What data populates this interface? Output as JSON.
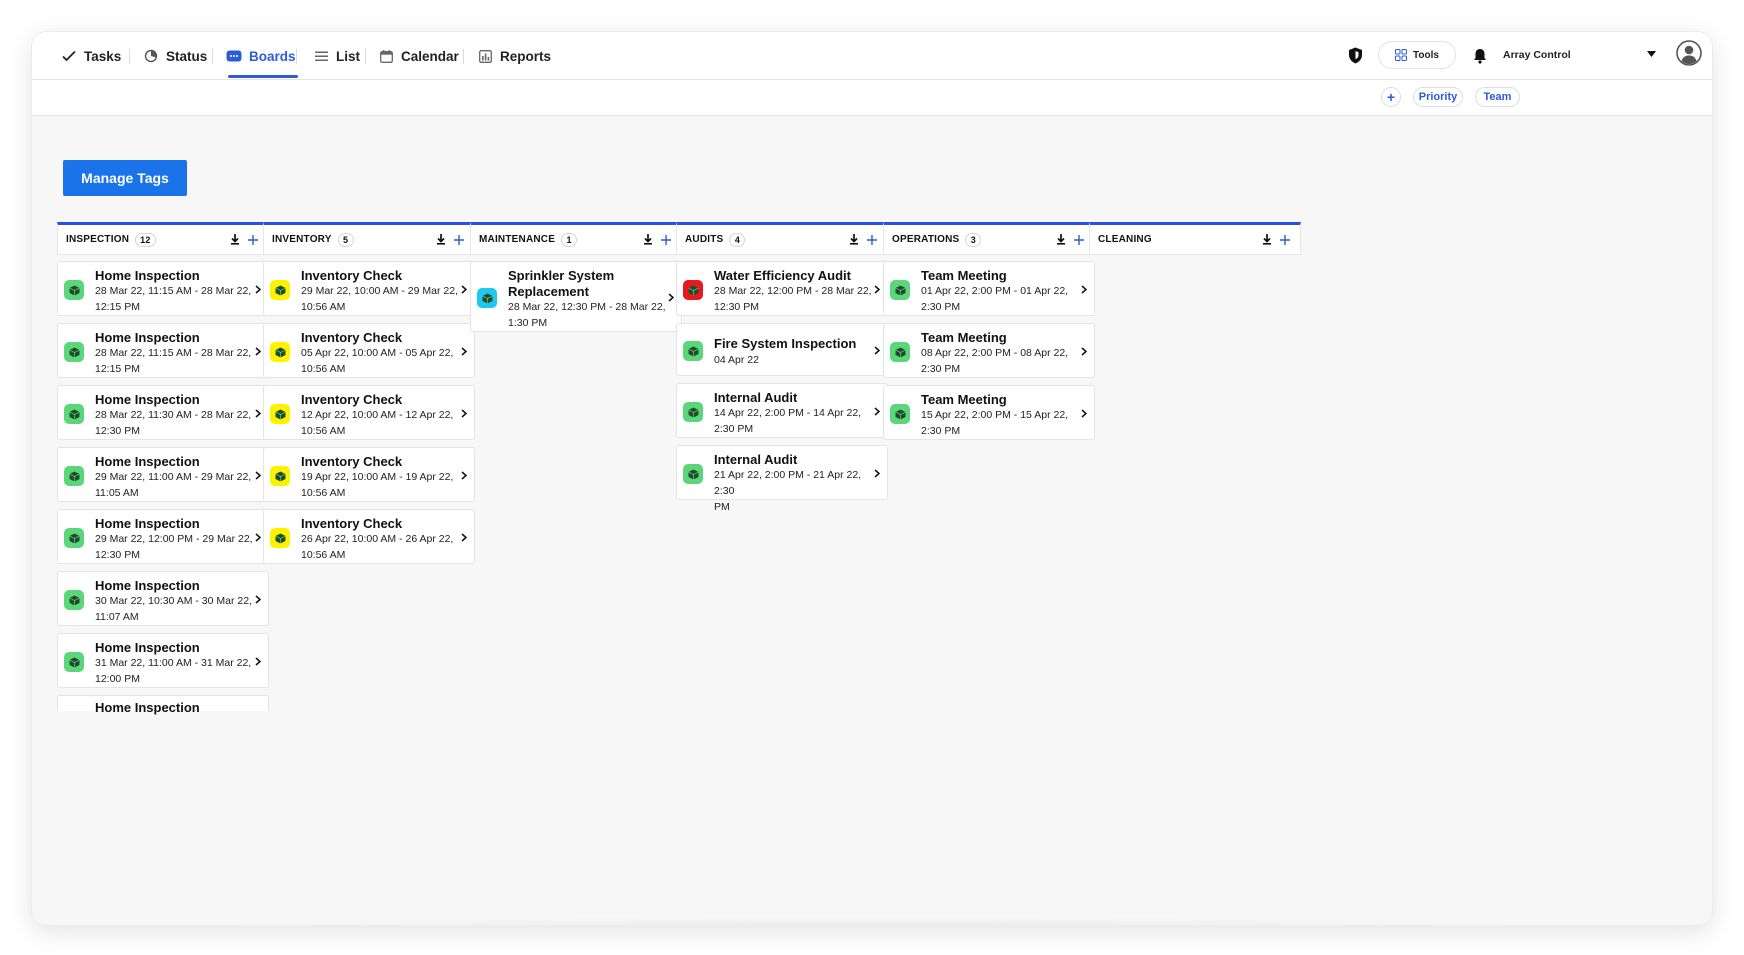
{
  "nav": {
    "tabs": [
      {
        "label": "Tasks",
        "icon": "check-icon"
      },
      {
        "label": "Status",
        "icon": "status-icon"
      },
      {
        "label": "Boards",
        "icon": "boards-icon",
        "active": true
      },
      {
        "label": "List",
        "icon": "list-icon"
      },
      {
        "label": "Calendar",
        "icon": "calendar-icon"
      },
      {
        "label": "Reports",
        "icon": "reports-icon"
      }
    ],
    "tools_label": "Tools",
    "user_name": "Array Control"
  },
  "filters": {
    "priority_label": "Priority",
    "team_label": "Team"
  },
  "manage_tags_label": "Manage Tags",
  "colors": {
    "accent": "#2c5cd6",
    "primary_button": "#1a73e8",
    "green_badge": "#5cd67a",
    "yellow_badge": "#fff200",
    "cyan_badge": "#1ec8f0",
    "red_badge": "#e8191f"
  },
  "columns": [
    {
      "name": "INSPECTION",
      "count": "12",
      "cards": [
        {
          "title": "Home Inspection",
          "time_1": "28 Mar 22, 11:15 AM - 28 Mar 22,",
          "time_2": "12:15 PM",
          "badge": "green"
        },
        {
          "title": "Home Inspection",
          "time_1": "28 Mar 22, 11:15 AM - 28 Mar 22,",
          "time_2": "12:15 PM",
          "badge": "green"
        },
        {
          "title": "Home Inspection",
          "time_1": "28 Mar 22, 11:30 AM - 28 Mar 22,",
          "time_2": "12:30 PM",
          "badge": "green"
        },
        {
          "title": "Home Inspection",
          "time_1": "29 Mar 22, 11:00 AM - 29 Mar 22,",
          "time_2": "11:05 AM",
          "badge": "green"
        },
        {
          "title": "Home Inspection",
          "time_1": "29 Mar 22, 12:00 PM - 29 Mar 22,",
          "time_2": "12:30 PM",
          "badge": "green"
        },
        {
          "title": "Home Inspection",
          "time_1": "30 Mar 22, 10:30 AM - 30 Mar 22,",
          "time_2": "11:07 AM",
          "badge": "green"
        },
        {
          "title": "Home Inspection",
          "time_1": "31 Mar 22, 11:00 AM - 31 Mar 22,",
          "time_2": "12:00 PM",
          "badge": "green"
        },
        {
          "title": "Home Inspection",
          "time_1": "",
          "time_2": "",
          "badge": "none"
        }
      ]
    },
    {
      "name": "INVENTORY",
      "count": "5",
      "cards": [
        {
          "title": "Inventory Check",
          "time_1": "29 Mar 22, 10:00 AM - 29 Mar 22,",
          "time_2": "10:56 AM",
          "badge": "yellow"
        },
        {
          "title": "Inventory Check",
          "time_1": "05 Apr 22, 10:00 AM - 05 Apr 22,",
          "time_2": "10:56 AM",
          "badge": "yellow"
        },
        {
          "title": "Inventory Check",
          "time_1": "12 Apr 22, 10:00 AM - 12 Apr 22,",
          "time_2": "10:56 AM",
          "badge": "yellow"
        },
        {
          "title": "Inventory Check",
          "time_1": "19 Apr 22, 10:00 AM - 19 Apr 22,",
          "time_2": "10:56 AM",
          "badge": "yellow"
        },
        {
          "title": "Inventory Check",
          "time_1": "26 Apr 22, 10:00 AM - 26 Apr 22,",
          "time_2": "10:56 AM",
          "badge": "yellow"
        }
      ]
    },
    {
      "name": "MAINTENANCE",
      "count": "1",
      "cards": [
        {
          "title": "Sprinkler System",
          "title_2": "Replacement",
          "time_1": "28 Mar 22, 12:30 PM - 28 Mar 22,",
          "time_2": "1:30 PM",
          "badge": "cyan"
        }
      ]
    },
    {
      "name": "AUDITS",
      "count": "4",
      "cards": [
        {
          "title": "Water Efficiency Audit",
          "time_1": "28 Mar 22, 12:00 PM - 28 Mar 22,",
          "time_2": "12:30 PM",
          "badge": "red"
        },
        {
          "title": "Fire System Inspection",
          "time_1": "04 Apr 22",
          "time_2": "",
          "badge": "green"
        },
        {
          "title": "Internal Audit",
          "time_1": "14 Apr 22, 2:00 PM - 14 Apr 22,",
          "time_2": "2:30 PM",
          "badge": "green"
        },
        {
          "title": "Internal Audit",
          "time_1": "21 Apr 22, 2:00 PM - 21 Apr 22, 2:30",
          "time_2": "PM",
          "badge": "green"
        }
      ]
    },
    {
      "name": "OPERATIONS",
      "count": "3",
      "cards": [
        {
          "title": "Team Meeting",
          "time_1": "01 Apr 22, 2:00 PM - 01 Apr 22,",
          "time_2": "2:30 PM",
          "badge": "green"
        },
        {
          "title": "Team Meeting",
          "time_1": "08 Apr 22, 2:00 PM - 08 Apr 22,",
          "time_2": "2:30 PM",
          "badge": "green"
        },
        {
          "title": "Team Meeting",
          "time_1": "15 Apr 22, 2:00 PM - 15 Apr 22,",
          "time_2": "2:30 PM",
          "badge": "green"
        }
      ]
    },
    {
      "name": "CLEANING",
      "count": "",
      "cards": []
    }
  ]
}
